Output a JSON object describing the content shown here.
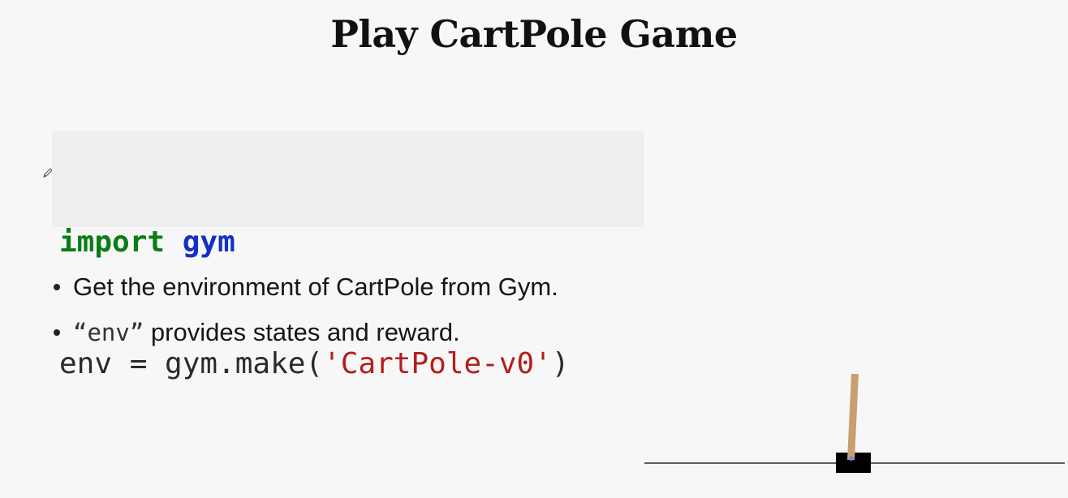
{
  "slide": {
    "title": "Play CartPole Game"
  },
  "code": {
    "line1_keyword": "import",
    "line1_module": "gym",
    "line2_prefix": "env = gym.make(",
    "line2_string": "'CartPole-v0'",
    "line2_suffix": ")"
  },
  "bullets": {
    "item1": "Get the environment of CartPole from Gym.",
    "item2_quoted": "“env”",
    "item2_rest": " provides states and reward."
  },
  "colors": {
    "keyword": "#0a7d14",
    "module": "#1530c8",
    "string": "#b31d1d",
    "background": "#f7f7f7",
    "code_background": "#eeeeee",
    "pole": "#c8a070",
    "cart": "#000000"
  },
  "icons": {
    "annotation": "pencil-icon"
  }
}
